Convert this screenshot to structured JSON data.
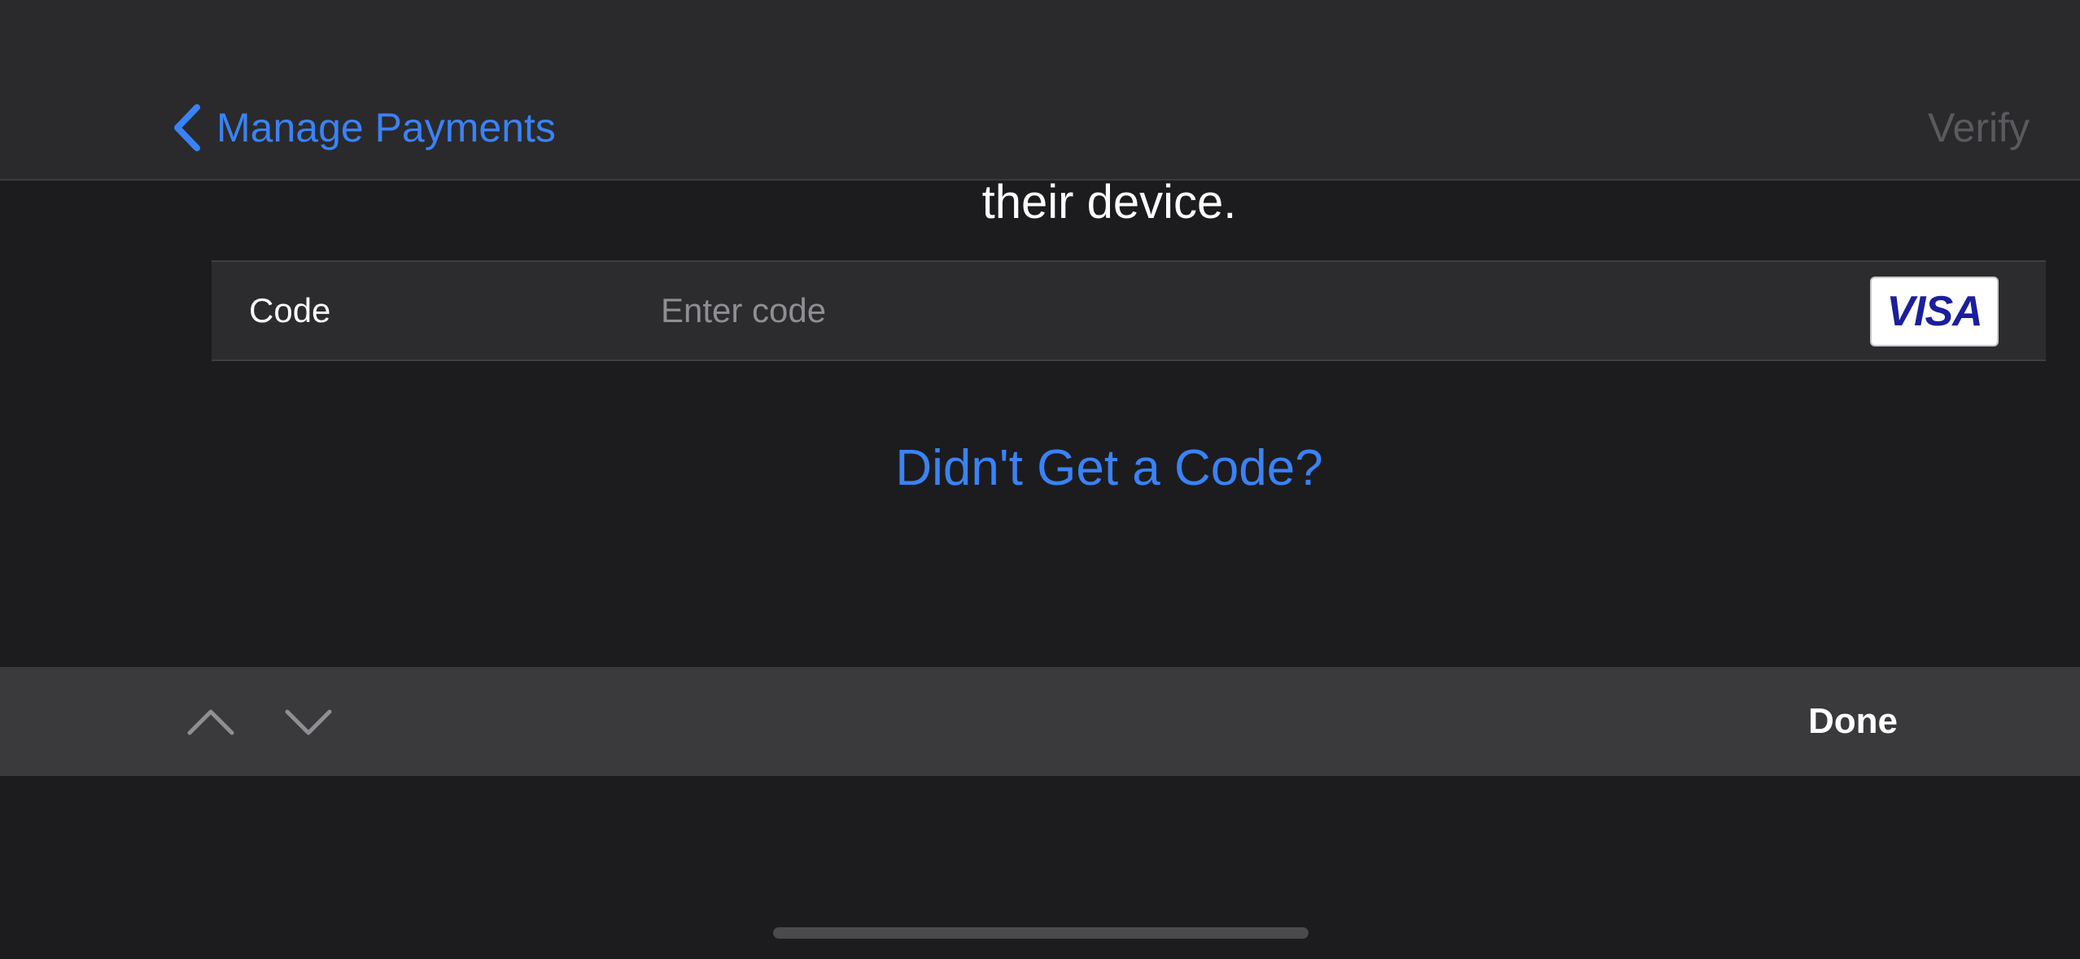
{
  "navbar": {
    "back_label": "Manage Payments",
    "verify_label": "Verify"
  },
  "content": {
    "description_tail": "their device.",
    "code_field": {
      "label": "Code",
      "value": "",
      "placeholder": "Enter code"
    },
    "card_brand": "VISA",
    "resend_link": "Didn't Get a Code?"
  },
  "accessory_bar": {
    "prev_icon": "chevron-up-icon",
    "next_icon": "chevron-down-icon",
    "done_label": "Done"
  },
  "colors": {
    "accent": "#3a82f7",
    "background": "#1c1c1e",
    "navbar": "#2a2a2c",
    "row_background": "#2c2c2e",
    "toolbar": "#3a3a3c",
    "disabled_text": "#5a5a5e",
    "visa_blue": "#1a1f9c"
  }
}
